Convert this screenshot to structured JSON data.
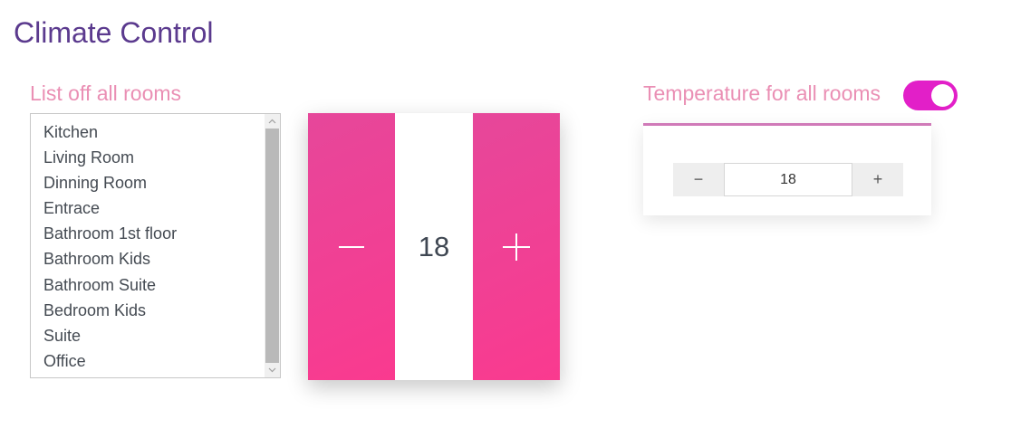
{
  "header": {
    "title": "Climate Control"
  },
  "rooms": {
    "label": "List off all rooms",
    "items": [
      "Kitchen",
      "Living Room",
      "Dinning Room",
      "Entrace",
      "Bathroom 1st floor",
      "Bathroom Kids",
      "Bathroom Suite",
      "Bedroom Kids",
      "Suite",
      "Office"
    ]
  },
  "big_stepper": {
    "value": "18",
    "minus_icon": "minus-icon",
    "plus_icon": "plus-icon",
    "gradient_start": "#e6479a",
    "gradient_end": "#fa3a8f"
  },
  "all_rooms": {
    "label": "Temperature for all rooms",
    "toggle_on": true,
    "toggle_color": "#e21fc8",
    "value": "18",
    "minus_label": "−",
    "plus_label": "+"
  },
  "colors": {
    "title": "#5b3a8e",
    "section_label": "#ea8fb4",
    "card_accent": "#d07ab8"
  }
}
